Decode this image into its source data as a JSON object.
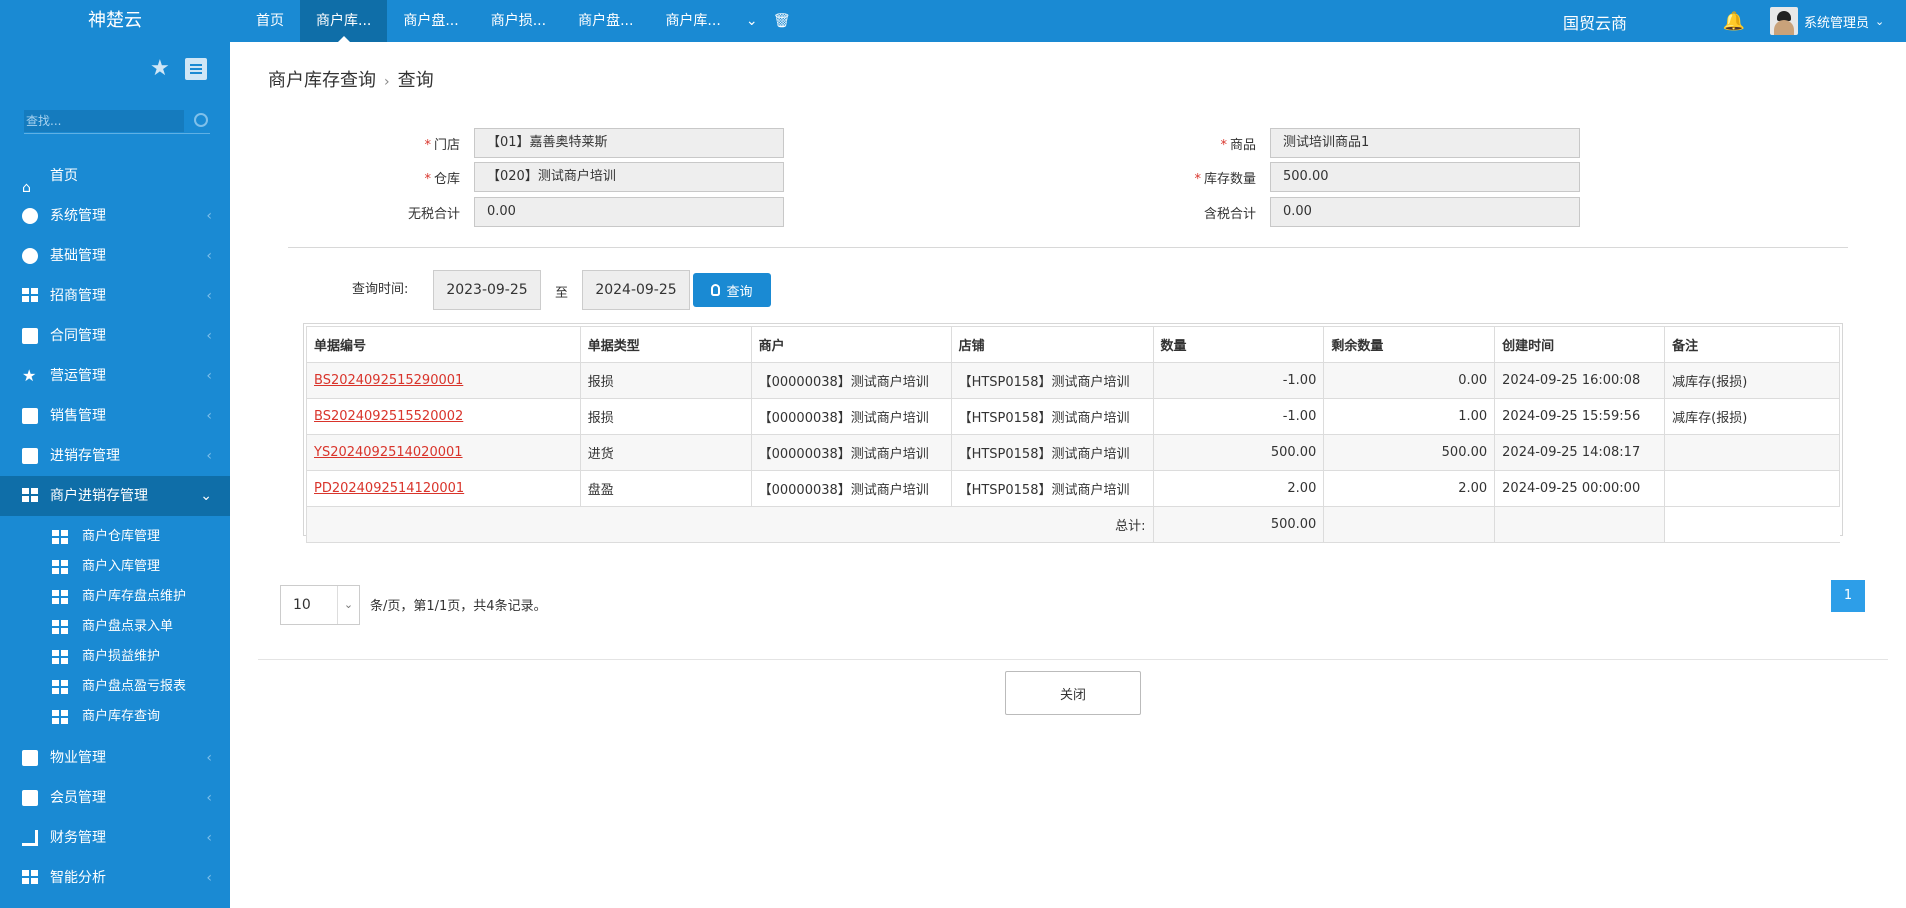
{
  "brand": "神楚云",
  "topnav": {
    "tabs": [
      "首页",
      "商户库...",
      "商户盘...",
      "商户损...",
      "商户盘...",
      "商户库..."
    ],
    "active_index": 1,
    "title": "国贸云商",
    "user": "系统管理员"
  },
  "sidebar": {
    "search_placeholder": "查找...",
    "items": [
      "首页",
      "系统管理",
      "基础管理",
      "招商管理",
      "合同管理",
      "营运管理",
      "销售管理",
      "进销存管理",
      "商户进销存管理"
    ],
    "submenu": [
      "商户仓库管理",
      "商户入库管理",
      "商户库存盘点维护",
      "商户盘点录入单",
      "商户损益维护",
      "商户盘点盈亏报表",
      "商户库存查询"
    ],
    "items_after": [
      "物业管理",
      "会员管理",
      "财务管理",
      "智能分析"
    ]
  },
  "breadcrumb": {
    "parent": "商户库存查询",
    "sep": "›",
    "current": "查询"
  },
  "form": {
    "store_label": "门店",
    "store_value": "【01】嘉善奥特莱斯",
    "product_label": "商品",
    "product_value": "测试培训商品1",
    "warehouse_label": "仓库",
    "warehouse_value": "【020】测试商户培训",
    "qty_label": "库存数量",
    "qty_value": "500.00",
    "notax_label": "无税合计",
    "notax_value": "0.00",
    "tax_label": "含税合计",
    "tax_value": "0.00",
    "req_mark": "*"
  },
  "query": {
    "label": "查询时间:",
    "start": "2023-09-25",
    "to": "至",
    "end": "2024-09-25",
    "button": "查询"
  },
  "table": {
    "headers": [
      "单据编号",
      "单据类型",
      "商户",
      "店铺",
      "数量",
      "剩余数量",
      "创建时间",
      "备注"
    ],
    "rows": [
      [
        "BS2024092515290001",
        "报损",
        "【00000038】测试商户培训",
        "【HTSP0158】测试商户培训",
        "-1.00",
        "0.00",
        "2024-09-25 16:00:08",
        "减库存(报损)"
      ],
      [
        "BS2024092515520002",
        "报损",
        "【00000038】测试商户培训",
        "【HTSP0158】测试商户培训",
        "-1.00",
        "1.00",
        "2024-09-25 15:59:56",
        "减库存(报损)"
      ],
      [
        "YS2024092514020001",
        "进货",
        "【00000038】测试商户培训",
        "【HTSP0158】测试商户培训",
        "500.00",
        "500.00",
        "2024-09-25 14:08:17",
        ""
      ],
      [
        "PD2024092514120001",
        "盘盈",
        "【00000038】测试商户培训",
        "【HTSP0158】测试商户培训",
        "2.00",
        "2.00",
        "2024-09-25 00:00:00",
        ""
      ]
    ],
    "total_label": "总计:",
    "total_value": "500.00"
  },
  "pager": {
    "size": "10",
    "info": "条/页，第1/1页，共4条记录。",
    "page": "1"
  },
  "close_button": "关闭"
}
